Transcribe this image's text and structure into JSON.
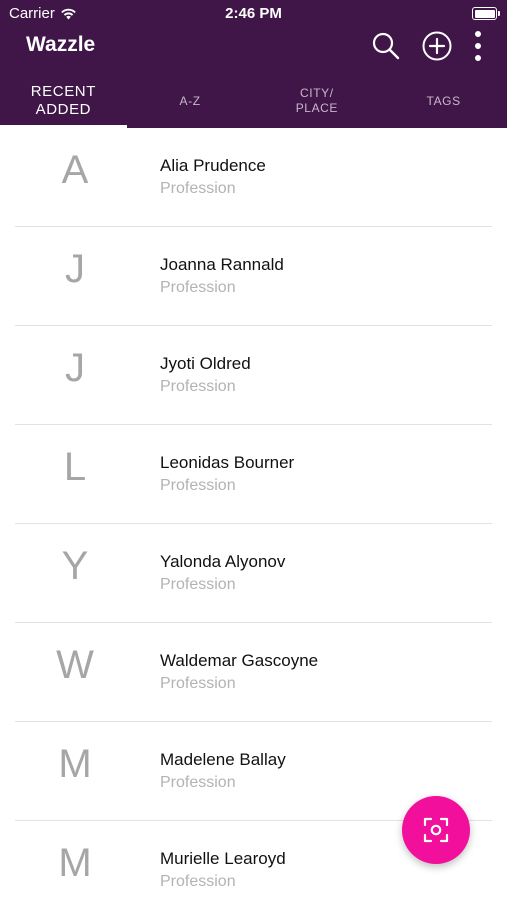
{
  "status_bar": {
    "carrier": "Carrier",
    "time": "2:46 PM"
  },
  "app": {
    "title": "Wazzle"
  },
  "actions": {
    "search_icon": "search-icon",
    "add_icon": "add-circle-icon",
    "menu_icon": "more-vertical-icon"
  },
  "tabs": [
    {
      "label": "RECENT\nADDED",
      "active": true
    },
    {
      "label": "A-Z",
      "active": false
    },
    {
      "label": "CITY/\nPLACE",
      "active": false
    },
    {
      "label": "TAGS",
      "active": false
    }
  ],
  "contacts": [
    {
      "initial": "A",
      "name": "Alia Prudence",
      "profession": "Profession"
    },
    {
      "initial": "J",
      "name": "Joanna Rannald",
      "profession": "Profession"
    },
    {
      "initial": "J",
      "name": "Jyoti Oldred",
      "profession": "Profession"
    },
    {
      "initial": "L",
      "name": "Leonidas Bourner",
      "profession": "Profession"
    },
    {
      "initial": "Y",
      "name": "Yalonda Alyonov",
      "profession": "Profession"
    },
    {
      "initial": "W",
      "name": "Waldemar Gascoyne",
      "profession": "Profession"
    },
    {
      "initial": "M",
      "name": "Madelene Ballay",
      "profession": "Profession"
    },
    {
      "initial": "M",
      "name": "Murielle Learoyd",
      "profession": "Profession"
    }
  ],
  "fab": {
    "icon": "scan-icon"
  },
  "colors": {
    "header": "#3f1647",
    "fab": "#f20f9c",
    "muted": "#a6a6a6"
  }
}
